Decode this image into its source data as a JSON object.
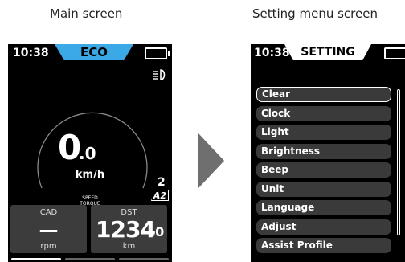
{
  "captions": {
    "main": "Main screen",
    "setting": "Setting menu screen"
  },
  "main_screen": {
    "time": "10:38",
    "mode": "ECO",
    "battery_icon": "battery-icon",
    "headlight_icon": "headlight-icon",
    "speed_integer": "0",
    "speed_decimal": ".0",
    "speed_unit": "km/h",
    "speed_label": "SPEED",
    "torque_label": "TORQUE",
    "assist_level": "2",
    "assist_profile": "A2",
    "cadence": {
      "title": "CAD",
      "value": "—",
      "unit": "rpm"
    },
    "distance": {
      "title": "DST",
      "value_integer": "1234",
      "value_decimal": ".0",
      "unit": "km"
    },
    "page_indicator": {
      "pages": 3,
      "active": 1
    },
    "colors": {
      "mode_tab": "#3aa9e6",
      "background": "#000000",
      "panel": "#3c3c3c"
    }
  },
  "setting_screen": {
    "time": "10:38",
    "title": "SETTING",
    "battery_icon": "battery-icon",
    "menu_items": [
      {
        "label": "Clear",
        "selected": true
      },
      {
        "label": "Clock",
        "selected": false
      },
      {
        "label": "Light",
        "selected": false
      },
      {
        "label": "Brightness",
        "selected": false
      },
      {
        "label": "Beep",
        "selected": false
      },
      {
        "label": "Unit",
        "selected": false
      },
      {
        "label": "Language",
        "selected": false
      },
      {
        "label": "Adjust",
        "selected": false
      },
      {
        "label": "Assist Profile",
        "selected": false
      }
    ]
  },
  "transition_icon": "arrow-right-icon"
}
